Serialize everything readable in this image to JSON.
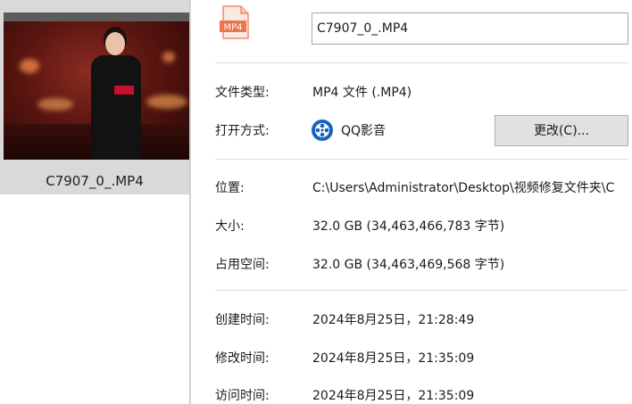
{
  "explorer": {
    "selected_file_name": "C7907_0_.MP4"
  },
  "properties": {
    "file_icon_label": "MP4",
    "file_name_value": "C7907_0_.MP4",
    "file_type": {
      "label": "文件类型:",
      "value": "MP4 文件 (.MP4)"
    },
    "opens_with": {
      "label": "打开方式:",
      "app_name": "QQ影音",
      "change_button": "更改(C)..."
    },
    "location": {
      "label": "位置:",
      "value": "C:\\Users\\Administrator\\Desktop\\视频修复文件夹\\C"
    },
    "size": {
      "label": "大小:",
      "value": "32.0 GB (34,463,466,783 字节)"
    },
    "size_on_disk": {
      "label": "占用空间:",
      "value": "32.0 GB (34,463,469,568 字节)"
    },
    "created": {
      "label": "创建时间:",
      "value": "2024年8月25日，21:28:49"
    },
    "modified": {
      "label": "修改时间:",
      "value": "2024年8月25日，21:35:09"
    },
    "accessed": {
      "label": "访问时间:",
      "value": "2024年8月25日，21:35:09"
    }
  },
  "colors": {
    "file_icon_accent": "#e8764f",
    "app_icon_blue": "#1565c0",
    "button_bg": "#e1e1e1",
    "thumbnail_card": "#c8102e"
  }
}
